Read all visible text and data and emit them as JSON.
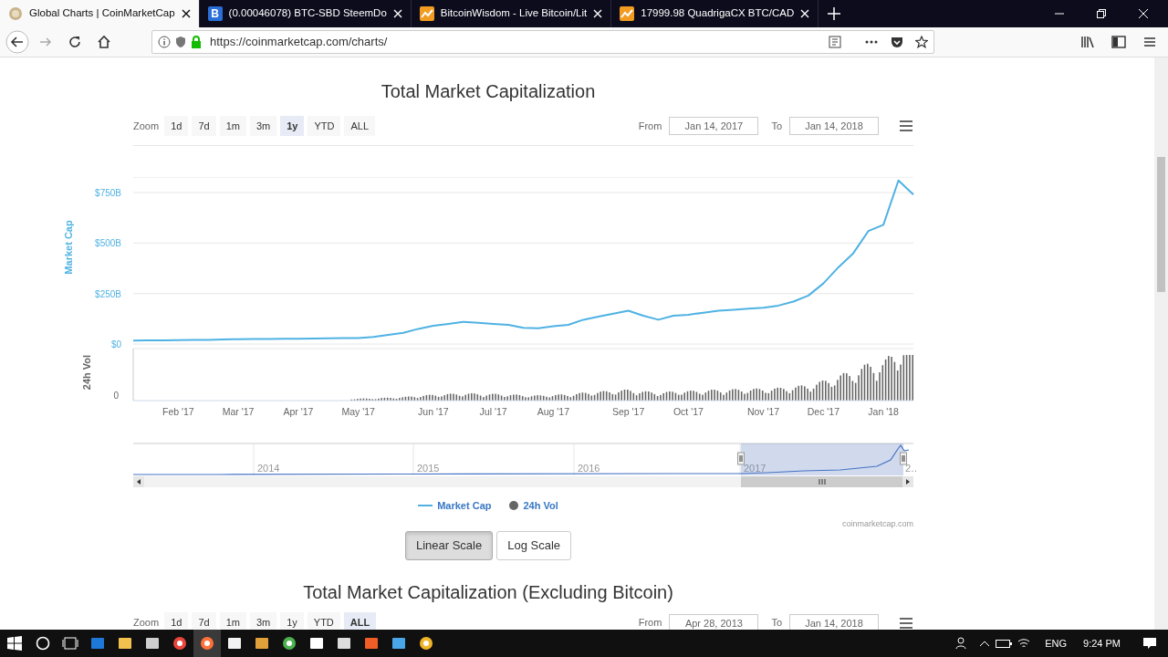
{
  "browser": {
    "tabs": [
      {
        "title": "Global Charts | CoinMarketCap",
        "kind": "coin",
        "selected": true
      },
      {
        "title": "(0.00046078) BTC-SBD SteemDo",
        "kind": "letter",
        "letter": "B",
        "selected": false
      },
      {
        "title": "BitcoinWisdom - Live Bitcoin/Lit",
        "kind": "chart",
        "selected": false
      },
      {
        "title": "17999.98 QuadrigaCX BTC/CAD",
        "kind": "chart",
        "selected": false
      }
    ],
    "address": "https://coinmarketcap.com/charts/"
  },
  "charts": [
    {
      "title": "Total Market Capitalization",
      "zoom_label": "Zoom",
      "zoom_options": [
        {
          "label": "1d",
          "selected": false
        },
        {
          "label": "7d",
          "selected": false
        },
        {
          "label": "1m",
          "selected": false
        },
        {
          "label": "3m",
          "selected": false
        },
        {
          "label": "1y",
          "selected": true
        },
        {
          "label": "YTD",
          "selected": false
        },
        {
          "label": "ALL",
          "selected": false
        }
      ],
      "from_label": "From",
      "from": "Jan 14, 2017",
      "to_label": "To",
      "to": "Jan 14, 2018",
      "chart_data": {
        "type": "line",
        "ylabel": "Market Cap",
        "grid": true,
        "ylim": [
          0,
          825
        ],
        "categories": [
          null,
          null,
          null,
          "Feb '17",
          null,
          null,
          null,
          "Mar '17",
          null,
          null,
          null,
          "Apr '17",
          null,
          null,
          null,
          "May '17",
          null,
          null,
          null,
          null,
          "Jun '17",
          null,
          null,
          null,
          "Jul '17",
          null,
          null,
          null,
          "Aug '17",
          null,
          null,
          null,
          null,
          "Sep '17",
          null,
          null,
          null,
          "Oct '17",
          null,
          null,
          null,
          null,
          "Nov '17",
          null,
          null,
          null,
          "Dec '17",
          null,
          null,
          null,
          "Jan '18",
          null,
          null
        ],
        "series": [
          {
            "name": "Market Cap",
            "color": "#4fb2e3",
            "values": [
              17,
              18,
              18,
              19,
              20,
              21,
              22,
              24,
              25,
              25,
              26,
              26,
              27,
              28,
              29,
              30,
              35,
              45,
              55,
              75,
              90,
              100,
              110,
              105,
              100,
              95,
              80,
              78,
              88,
              95,
              120,
              135,
              150,
              165,
              140,
              120,
              140,
              145,
              155,
              165,
              170,
              175,
              180,
              190,
              210,
              240,
              300,
              380,
              450,
              560,
              590,
              810,
              740
            ]
          }
        ],
        "yticks": [
          {
            "value": 0,
            "label": "$0"
          },
          {
            "value": 250,
            "label": "$250B"
          },
          {
            "value": 500,
            "label": "$500B"
          },
          {
            "value": 750,
            "label": "$750B"
          }
        ]
      },
      "volume_axis": {
        "title": "24h Vol",
        "tick": "0"
      },
      "navigator": {
        "labels": [
          "2014",
          "2015",
          "2016",
          "2017",
          "2…"
        ]
      },
      "legend": [
        {
          "kind": "series"
        },
        {
          "label": "24h Vol",
          "kind": "dot",
          "color": "#666666"
        }
      ],
      "credits": "coinmarketcap.com",
      "scales": [
        {
          "label": "Linear Scale",
          "selected": true
        },
        {
          "label": "Log Scale",
          "selected": false
        }
      ]
    },
    {
      "title": "Total Market Capitalization (Excluding Bitcoin)",
      "zoom_label": "Zoom",
      "zoom_options": [
        {
          "label": "1d",
          "selected": false
        },
        {
          "label": "7d",
          "selected": false
        },
        {
          "label": "1m",
          "selected": false
        },
        {
          "label": "3m",
          "selected": false
        },
        {
          "label": "1y",
          "selected": false
        },
        {
          "label": "YTD",
          "selected": false
        },
        {
          "label": "ALL",
          "selected": true
        }
      ],
      "from_label": "From",
      "from": "Apr 28, 2013",
      "to_label": "To",
      "to": "Jan 14, 2018"
    }
  ],
  "taskbar": {
    "language": "ENG",
    "time": "9:24 PM"
  }
}
